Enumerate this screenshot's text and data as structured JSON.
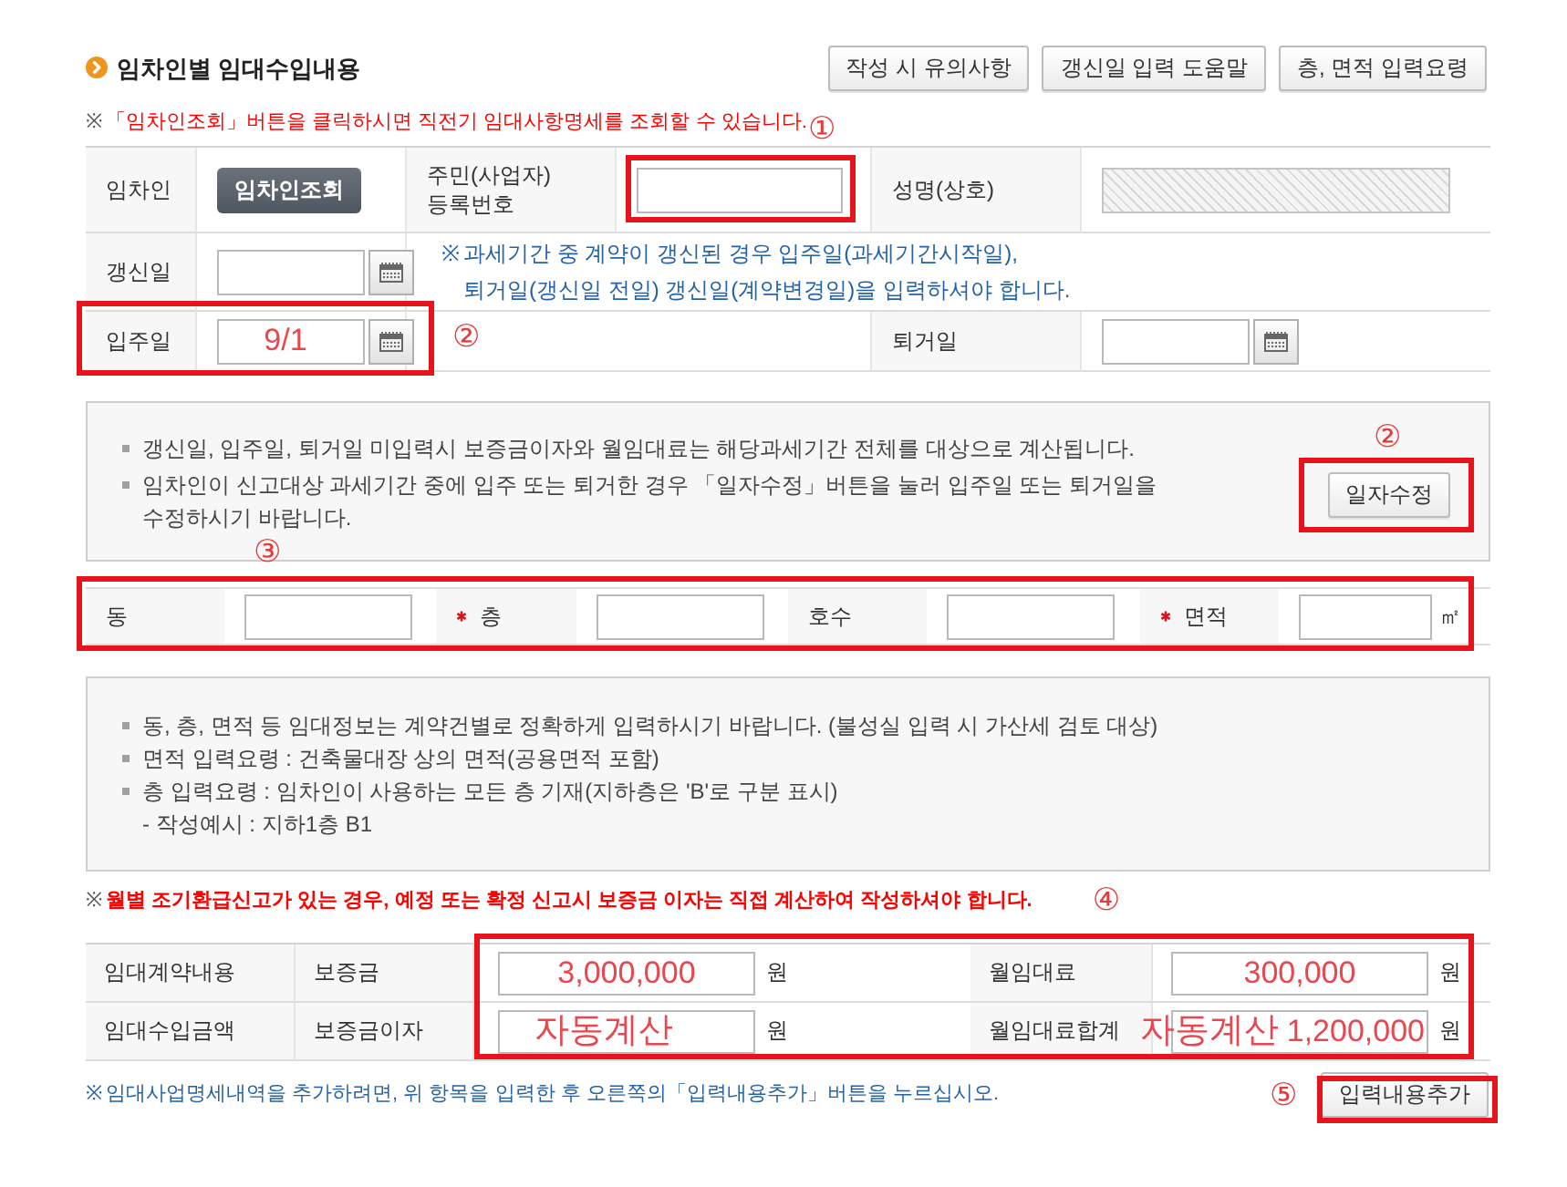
{
  "header": {
    "title": "임차인별 임대수입내용",
    "buttons": [
      "작성 시 유의사항",
      "갱신일 입력 도움말",
      "층, 면적 입력요령"
    ]
  },
  "notice": {
    "mark": "※",
    "text": "「임차인조회」버튼을 클릭하시면 직전기 임대사항명세를 조회할 수 있습니다."
  },
  "tenant_form": {
    "tenant": {
      "label": "임차인",
      "button": "임차인조회"
    },
    "resident_id": {
      "label": "주민(사업자)\n등록번호",
      "highlighted": true,
      "marker": "①"
    },
    "name": {
      "label": "성명(상호)",
      "disabled": true
    },
    "renewal_date": {
      "label": "갱신일"
    },
    "renewal_note": {
      "mark": "※",
      "text": "과세기간 중 계약이 갱신된 경우 입주일(과세기간시작일),\n퇴거일(갱신일 전일) 갱신일(계약변경일)을 입력하셔야 합니다."
    },
    "move_in_date": {
      "label": "입주일",
      "value": "9/1",
      "highlighted": true,
      "marker": "②"
    },
    "move_out_date": {
      "label": "퇴거일"
    }
  },
  "date_notice": {
    "items": [
      {
        "kind": "bullet",
        "text": "갱신일, 입주일, 퇴거일 미입력시 보증금이자와 월임대료는 해당과세기간 전체를 대상으로 계산됩니다."
      },
      {
        "kind": "bullet",
        "text": "임차인이 신고대상 과세기간 중에 입주 또는 퇴거한 경우 「일자수정」버튼을 눌러 입주일 또는 퇴거일을 수정하시기 바랍니다."
      }
    ],
    "button": {
      "label": "일자수정",
      "highlighted": true,
      "marker": "②"
    }
  },
  "unit_row": {
    "highlighted": true,
    "marker": "③",
    "fields": [
      {
        "label": "동",
        "required": false
      },
      {
        "label": "층",
        "required": true
      },
      {
        "label": "호수",
        "required": false
      },
      {
        "label": "면적",
        "required": true,
        "unit": "㎡"
      }
    ]
  },
  "unit_notice": {
    "items": [
      {
        "kind": "bullet",
        "text": "동, 층, 면적 등 임대정보는 계약건별로  정확하게 입력하시기 바랍니다. (불성실 입력 시 가산세 검토 대상)"
      },
      {
        "kind": "bullet",
        "text": "면적 입력요령 : 건축물대장 상의 면적(공용면적 포함)"
      },
      {
        "kind": "bullet",
        "text": "층 입력요령 : 임차인이 사용하는 모든 층 기재(지하층은 'B'로 구분 표시)"
      },
      {
        "kind": "sub",
        "text": "- 작성예시 : 지하1층 B1"
      }
    ]
  },
  "warning": {
    "mark": "※",
    "text": "월별 조기환급신고가 있는 경우, 예정 또는 확정 신고시 보증금 이자는 직접 계산하여 작성하셔야 합니다.",
    "marker": "④"
  },
  "amounts": {
    "highlighted": true,
    "rows": [
      {
        "heading": "임대계약내용",
        "cells": [
          {
            "label": "보증금",
            "value": "3,000,000",
            "unit": "원"
          },
          {
            "label": "월임대료",
            "value": "300,000",
            "unit": "원"
          }
        ]
      },
      {
        "heading": "임대수입금액",
        "cells": [
          {
            "label": "보증금이자",
            "annotation": "자동계산",
            "unit": "원"
          },
          {
            "label": "월임대료합계",
            "annotation": "자동계산",
            "value": "1,200,000",
            "unit": "원"
          }
        ]
      }
    ]
  },
  "footer": {
    "mark": "※",
    "text": "임대사업명세내역을 추가하려면, 위 항목을 입력한 후 오른쪽의「입력내용추가」버튼을 누르십시오.",
    "button": {
      "label": "입력내용추가",
      "highlighted": true,
      "marker": "⑤"
    }
  }
}
